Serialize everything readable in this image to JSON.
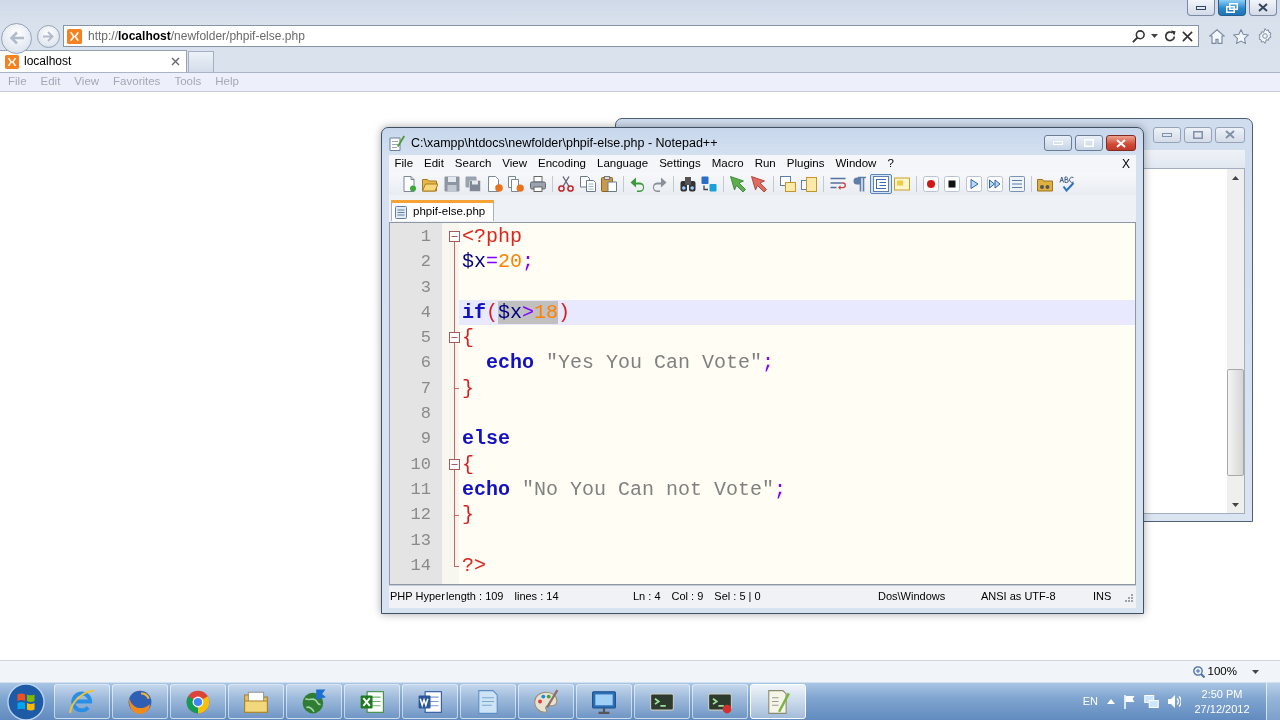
{
  "browser": {
    "window_buttons": [
      {
        "kind": "minimize",
        "highlighted": false
      },
      {
        "kind": "restore",
        "highlighted": true
      },
      {
        "kind": "close",
        "highlighted": false
      }
    ],
    "address": "http://**localhost**/newfolder/phpif-else.php",
    "tabs": [
      {
        "label": "localhost",
        "selected": true
      }
    ],
    "active": false,
    "menu": [
      "File",
      "Edit",
      "View",
      "Favorites",
      "Tools",
      "Help"
    ],
    "zoom": "100%"
  },
  "editor": {
    "title": "C:\\xampp\\htdocs\\newfolder\\phpif-else.php - Notepad++",
    "menu": [
      "File",
      "Edit",
      "Search",
      "View",
      "Encoding",
      "Language",
      "Settings",
      "Macro",
      "Run",
      "Plugins",
      "Window",
      "?"
    ],
    "close_document": "X",
    "toolbar": [
      [
        {
          "kind": "new"
        },
        {
          "kind": "open"
        },
        {
          "kind": "save"
        },
        {
          "kind": "save_all"
        },
        {
          "kind": "close"
        },
        {
          "kind": "close_all"
        },
        {
          "kind": "print"
        }
      ],
      [
        {
          "kind": "cut"
        },
        {
          "kind": "copy"
        },
        {
          "kind": "paste"
        }
      ],
      [
        {
          "kind": "undo"
        },
        {
          "kind": "redo"
        }
      ],
      [
        {
          "kind": "find"
        },
        {
          "kind": "replace"
        }
      ],
      [
        {
          "kind": "zoom_in"
        },
        {
          "kind": "zoom_out"
        }
      ],
      [
        {
          "kind": "sync_vertical",
          "on": false
        },
        {
          "kind": "sync_horizontal",
          "on": false
        }
      ],
      [
        {
          "kind": "word_wrap",
          "on": false
        },
        {
          "kind": "all_characters",
          "on": false
        },
        {
          "kind": "indent_guide",
          "on": true
        },
        {
          "kind": "language_panel",
          "on": false
        }
      ],
      [
        {
          "kind": "record"
        },
        {
          "kind": "stop"
        },
        {
          "kind": "play"
        },
        {
          "kind": "play_multiple"
        },
        {
          "kind": "save_macro"
        }
      ],
      [
        {
          "kind": "folder"
        },
        {
          "kind": "spellcheck"
        }
      ]
    ],
    "tabs": [
      {
        "label": "phpif-else.php",
        "selected": true
      }
    ],
    "lines": [
      {
        "number": "1",
        "kind": "fold_start",
        "current": false,
        "indented": false,
        "tokens": [
          {
            "text": "<?php",
            "kind": "tag",
            "selected": false,
            "spaced": false
          }
        ]
      },
      {
        "number": "2",
        "kind": "fold_body",
        "current": false,
        "indented": false,
        "tokens": [
          {
            "text": "$x",
            "kind": "variable",
            "selected": false,
            "spaced": false
          },
          {
            "text": "=",
            "kind": "operator",
            "selected": false,
            "spaced": false
          },
          {
            "text": "20",
            "kind": "number",
            "selected": false,
            "spaced": false
          },
          {
            "text": ";",
            "kind": "operator",
            "selected": false,
            "spaced": false
          }
        ]
      },
      {
        "number": "3",
        "kind": "fold_body",
        "current": false
      },
      {
        "number": "4",
        "kind": "fold_body",
        "current": true,
        "indented": false,
        "tokens": [
          {
            "text": "if",
            "kind": "keyword",
            "selected": false,
            "spaced": false
          },
          {
            "text": "(",
            "kind": "bracket",
            "selected": false,
            "spaced": false
          },
          {
            "text": "$x",
            "kind": "variable",
            "selected": true,
            "spaced": false
          },
          {
            "text": ">",
            "kind": "operator",
            "selected": true,
            "spaced": false
          },
          {
            "text": "18",
            "kind": "number",
            "selected": true,
            "spaced": false
          },
          {
            "text": ")",
            "kind": "bracket",
            "selected": false,
            "spaced": false
          }
        ]
      },
      {
        "number": "5",
        "kind": "fold_start",
        "current": false,
        "indented": false,
        "tokens": [
          {
            "text": "{",
            "kind": "bracket",
            "selected": false,
            "spaced": false
          }
        ]
      },
      {
        "number": "6",
        "kind": "fold_body",
        "current": false,
        "indented": true,
        "tokens": [
          {
            "text": "echo",
            "kind": "keyword",
            "selected": false,
            "spaced": false
          },
          {
            "text": "\"Yes You Can Vote\"",
            "kind": "string",
            "selected": false,
            "spaced": true
          },
          {
            "text": ";",
            "kind": "operator",
            "selected": false,
            "spaced": false
          }
        ]
      },
      {
        "number": "7",
        "kind": "fold_end",
        "current": false,
        "indented": false,
        "tokens": [
          {
            "text": "}",
            "kind": "bracket",
            "selected": false,
            "spaced": false
          }
        ]
      },
      {
        "number": "8",
        "kind": "fold_body",
        "current": false
      },
      {
        "number": "9",
        "kind": "fold_body",
        "current": false,
        "indented": false,
        "tokens": [
          {
            "text": "else",
            "kind": "keyword",
            "selected": false,
            "spaced": false
          }
        ]
      },
      {
        "number": "10",
        "kind": "fold_start",
        "current": false,
        "indented": false,
        "tokens": [
          {
            "text": "{",
            "kind": "bracket",
            "selected": false,
            "spaced": false
          }
        ]
      },
      {
        "number": "11",
        "kind": "fold_body",
        "current": false,
        "indented": false,
        "tokens": [
          {
            "text": "echo",
            "kind": "keyword",
            "selected": false,
            "spaced": false
          },
          {
            "text": "\"No You Can not Vote\"",
            "kind": "string",
            "selected": false,
            "spaced": true
          },
          {
            "text": ";",
            "kind": "operator",
            "selected": false,
            "spaced": false
          }
        ]
      },
      {
        "number": "12",
        "kind": "fold_end",
        "current": false,
        "indented": false,
        "tokens": [
          {
            "text": "}",
            "kind": "bracket",
            "selected": false,
            "spaced": false
          }
        ]
      },
      {
        "number": "13",
        "kind": "fold_body",
        "current": false
      },
      {
        "number": "14",
        "kind": "fold_end",
        "current": false,
        "indented": false,
        "tokens": [
          {
            "text": "?>",
            "kind": "tag",
            "selected": false,
            "spaced": false
          }
        ]
      }
    ],
    "status_bar": [
      [
        "PHP Hyper"
      ],
      [
        "length : 109",
        "lines : 14"
      ],
      [
        "Ln : 4",
        "Col : 9",
        "Sel : 5 | 0"
      ],
      [
        "Dos\\Windows"
      ],
      [
        "ANSI as UTF-8"
      ],
      [
        "INS"
      ]
    ]
  },
  "taskbar": {
    "apps": [
      {
        "kind": "e_browser",
        "selected": false
      },
      {
        "kind": "fox_browser",
        "selected": false
      },
      {
        "kind": "circle_browser",
        "selected": false
      },
      {
        "kind": "folder",
        "selected": false
      },
      {
        "kind": "globe",
        "selected": false
      },
      {
        "kind": "spreadsheet",
        "selected": false
      },
      {
        "kind": "word_document",
        "selected": false
      },
      {
        "kind": "notepad",
        "selected": false
      },
      {
        "kind": "paint",
        "selected": false
      },
      {
        "kind": "monitor",
        "selected": false
      },
      {
        "kind": "terminal",
        "selected": false
      },
      {
        "kind": "terminal_record",
        "selected": false
      },
      {
        "kind": "code_editor",
        "selected": true
      }
    ],
    "language": "EN",
    "time": "2:50 PM",
    "date": "27/12/2012"
  }
}
